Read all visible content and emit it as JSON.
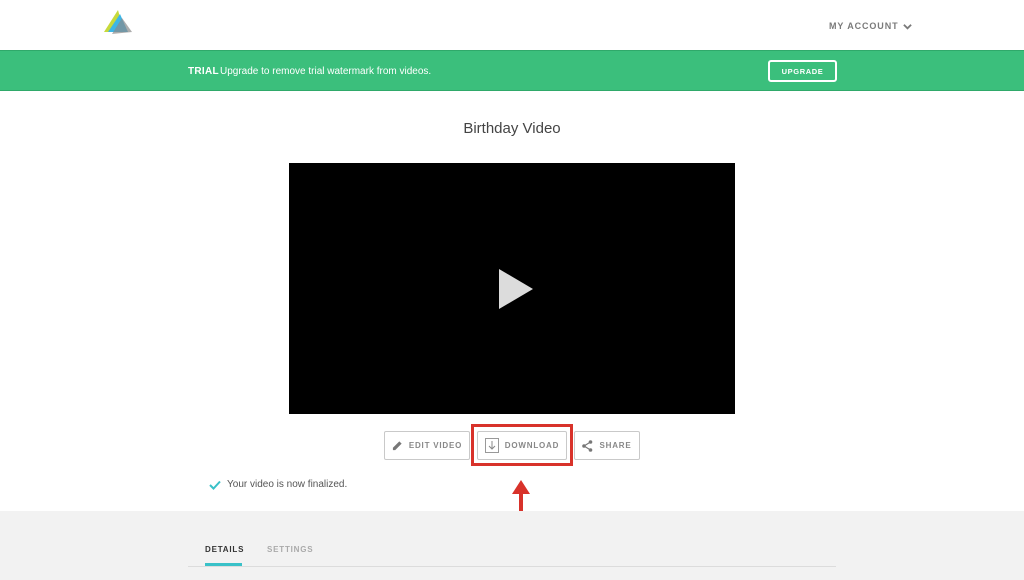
{
  "header": {
    "logo_icon": "stacked-triangles-logo",
    "account_label": "MY ACCOUNT",
    "account_icon": "chevron-down-icon"
  },
  "banner": {
    "badge": "TRIAL",
    "message": "Upgrade to remove trial watermark from videos.",
    "upgrade_label": "UPGRADE",
    "color": "#3bbf7c"
  },
  "video": {
    "title": "Birthday Video",
    "play_icon": "play-icon"
  },
  "actions": {
    "edit_label": "EDIT VIDEO",
    "download_label": "DOWNLOAD",
    "share_label": "SHARE",
    "highlight_color": "#d8322a"
  },
  "status": {
    "message": "Your video is now finalized.",
    "icon": "checkmark-icon",
    "icon_color": "#39c1c8"
  },
  "tabs": [
    {
      "label": "DETAILS",
      "active": true
    },
    {
      "label": "SETTINGS",
      "active": false
    }
  ]
}
